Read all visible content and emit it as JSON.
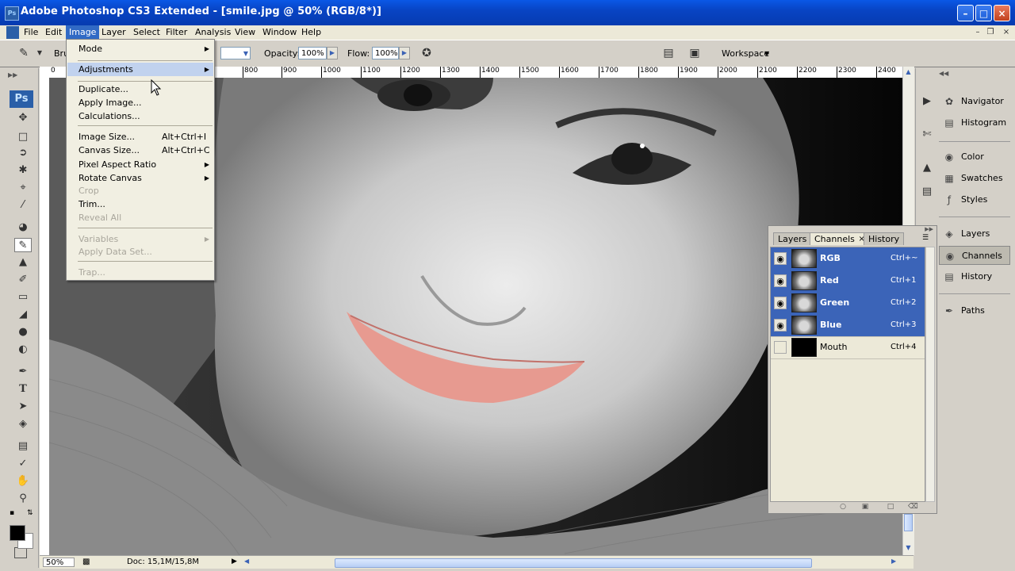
{
  "window": {
    "title": "Adobe Photoshop CS3 Extended - [smile.jpg @ 50% (RGB/8*)]",
    "app_icon": "Ps"
  },
  "menubar": {
    "items": [
      "File",
      "Edit",
      "Image",
      "Layer",
      "Select",
      "Filter",
      "Analysis",
      "View",
      "Window",
      "Help"
    ],
    "active": "Image"
  },
  "options": {
    "brush_label": "Bru",
    "opacity_label": "Opacity:",
    "opacity_value": "100%",
    "flow_label": "Flow:",
    "flow_value": "100%",
    "workspace_label": "Workspace"
  },
  "image_menu": [
    {
      "label": "Mode",
      "submenu": true
    },
    {
      "label": "Adjustments",
      "submenu": true,
      "highlighted": true
    },
    {
      "label": "Duplicate..."
    },
    {
      "label": "Apply Image..."
    },
    {
      "label": "Calculations..."
    },
    {
      "label": "Image Size...",
      "shortcut": "Alt+Ctrl+I"
    },
    {
      "label": "Canvas Size...",
      "shortcut": "Alt+Ctrl+C"
    },
    {
      "label": "Pixel Aspect Ratio",
      "submenu": true
    },
    {
      "label": "Rotate Canvas",
      "submenu": true
    },
    {
      "label": "Crop",
      "disabled": true
    },
    {
      "label": "Trim..."
    },
    {
      "label": "Reveal All",
      "disabled": true
    },
    {
      "label": "Variables",
      "submenu": true,
      "disabled": true
    },
    {
      "label": "Apply Data Set...",
      "disabled": true
    },
    {
      "label": "Trap...",
      "disabled": true
    }
  ],
  "ruler": {
    "ticks": [
      "0",
      "800",
      "900",
      "1000",
      "1100",
      "1200",
      "1300",
      "1400",
      "1500",
      "1600",
      "1700",
      "1800",
      "1900",
      "2000",
      "2100",
      "2200",
      "2300",
      "2400"
    ]
  },
  "toolbar": {
    "badge": "Ps"
  },
  "dock": {
    "group1": [
      "Navigator",
      "Histogram"
    ],
    "group2": [
      "Color",
      "Swatches",
      "Styles"
    ],
    "group3": [
      "Layers",
      "Channels",
      "History"
    ],
    "group4": [
      "Paths"
    ],
    "active": "Channels"
  },
  "channels_panel": {
    "tabs": [
      "Layers",
      "Channels",
      "History"
    ],
    "active_tab": "Channels",
    "rows": [
      {
        "name": "RGB",
        "shortcut": "Ctrl+~",
        "selected": true,
        "visible": true
      },
      {
        "name": "Red",
        "shortcut": "Ctrl+1",
        "selected": true,
        "visible": true
      },
      {
        "name": "Green",
        "shortcut": "Ctrl+2",
        "selected": true,
        "visible": true
      },
      {
        "name": "Blue",
        "shortcut": "Ctrl+3",
        "selected": true,
        "visible": true
      },
      {
        "name": "Mouth",
        "shortcut": "Ctrl+4",
        "selected": false,
        "visible": false
      }
    ]
  },
  "status": {
    "zoom": "50%",
    "doc": "Doc: 15,1M/15,8M"
  }
}
